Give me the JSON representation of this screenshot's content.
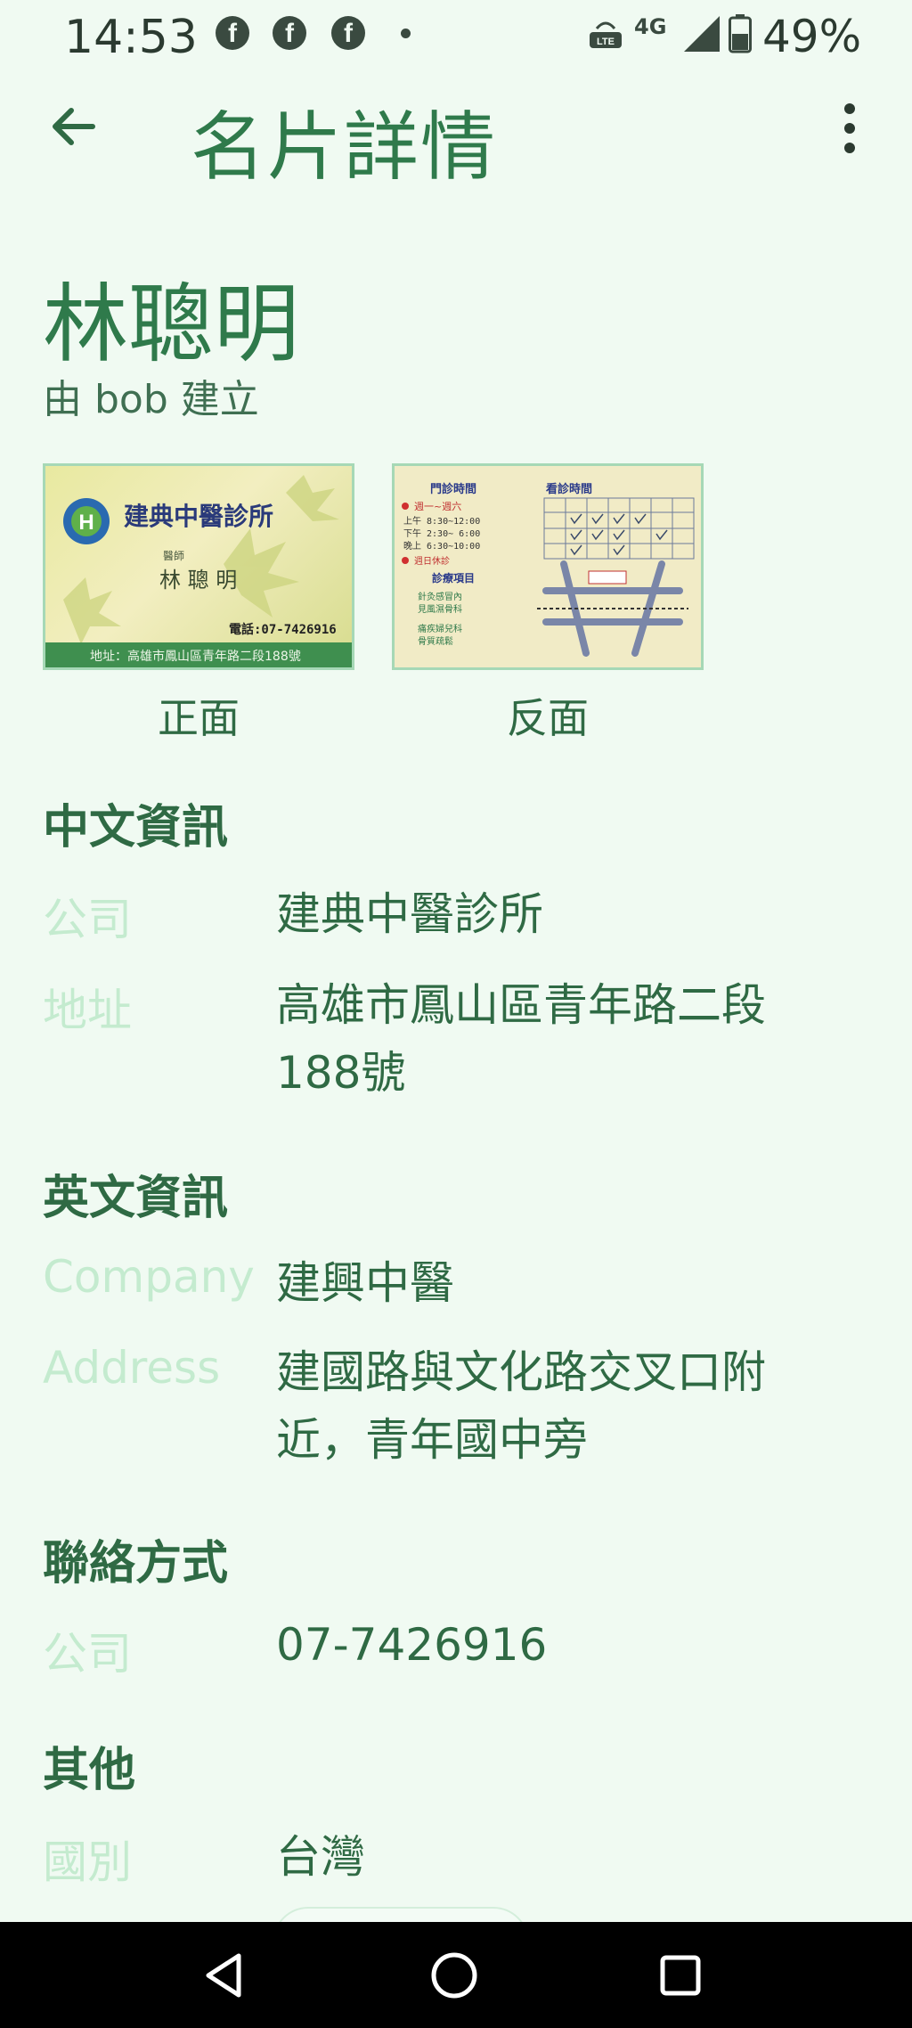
{
  "status_bar": {
    "time": "14:53",
    "notifications": [
      "facebook-icon",
      "facebook-icon",
      "facebook-icon"
    ],
    "network": "4G",
    "battery": "49%"
  },
  "app_bar": {
    "title": "名片詳情",
    "back_icon": "arrow-back-icon",
    "more_icon": "more-vert-icon"
  },
  "card": {
    "name": "林聰明",
    "creator": "由 bob 建立",
    "images": [
      {
        "caption": "正面"
      },
      {
        "caption": "反面"
      }
    ]
  },
  "front_card_text": {
    "clinic": "建典中醫診所",
    "role": "醫師",
    "person": "林 聰 明",
    "phone": "電話:07-7426916",
    "address": "地址：高雄市鳳山區青年路二段188號"
  },
  "back_card_text": {
    "hours_title": "門診時間",
    "visit_title": "看診時間",
    "weekdays": "週一~週六",
    "hours": [
      "上午 8:30~12:00",
      "下午 2:30~ 6:00",
      "晚上 6:30~10:00"
    ],
    "holiday": "週日休診",
    "services_title": "診療項目",
    "services": [
      "針灸感冒內",
      "見風濕骨科",
      "痛疾婦兒科",
      "骨質疏鬆"
    ]
  },
  "sections": {
    "chinese": {
      "title": "中文資訊",
      "company_label": "公司",
      "company": "建典中醫診所",
      "address_label": "地址",
      "address": "高雄市鳳山區青年路二段188號"
    },
    "english": {
      "title": "英文資訊",
      "company_label": "Company",
      "company": "建興中醫",
      "address_label": "Address",
      "address": "建國路與文化路交叉口附近，青年國中旁"
    },
    "contact": {
      "title": "聯絡方式",
      "company_label": "公司",
      "company_phone": "07-7426916"
    },
    "other": {
      "title": "其他",
      "country_label": "國別",
      "country": "台灣"
    }
  },
  "nav_bar": [
    "back-triangle-icon",
    "home-circle-icon",
    "recents-square-icon"
  ],
  "colors": {
    "background": "#f0faf2",
    "primary": "#2f7a4b",
    "label_faint": "#c4ebcf"
  }
}
